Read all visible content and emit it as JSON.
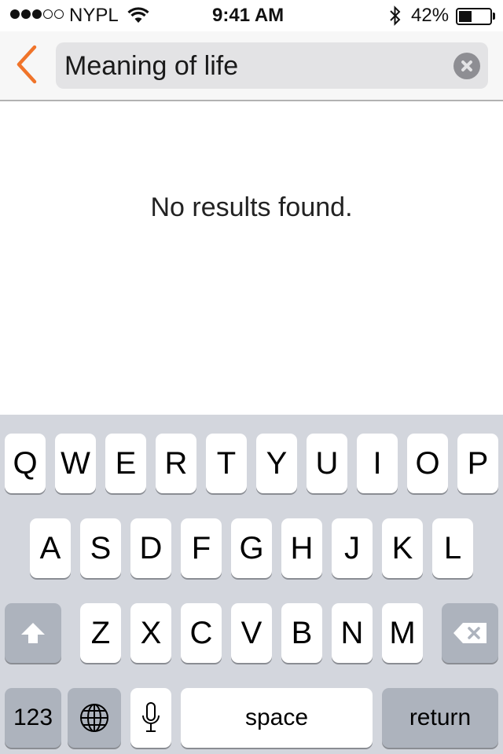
{
  "status_bar": {
    "carrier": "NYPL",
    "signal_bars": 3,
    "signal_total": 5,
    "time": "9:41 AM",
    "battery_percent": "42%",
    "battery_level": 0.42,
    "icons": [
      "wifi-icon",
      "bluetooth-icon",
      "battery-icon"
    ]
  },
  "search": {
    "query": "Meaning of life",
    "back_icon": "chevron-left-icon",
    "clear_icon": "clear-icon",
    "accent_color": "#f0742a"
  },
  "results": {
    "message": "No results found."
  },
  "keyboard": {
    "row1": [
      "Q",
      "W",
      "E",
      "R",
      "T",
      "Y",
      "U",
      "I",
      "O",
      "P"
    ],
    "row2": [
      "A",
      "S",
      "D",
      "F",
      "G",
      "H",
      "J",
      "K",
      "L"
    ],
    "row3": [
      "Z",
      "X",
      "C",
      "V",
      "B",
      "N",
      "M"
    ],
    "shift_icon": "shift-icon",
    "delete_icon": "delete-icon",
    "numbers_label": "123",
    "globe_icon": "globe-icon",
    "mic_icon": "microphone-icon",
    "space_label": "space",
    "return_label": "return"
  }
}
